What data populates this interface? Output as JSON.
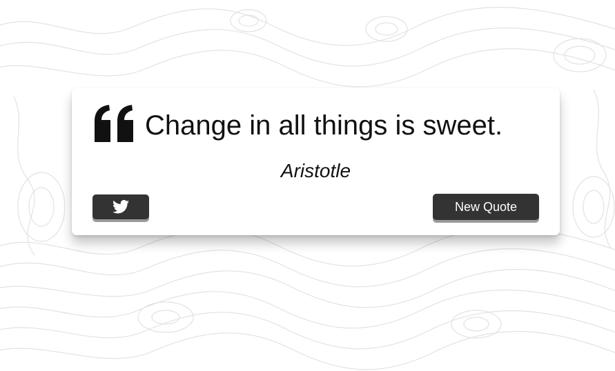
{
  "quote": {
    "text": "Change in all things is sweet.",
    "author": "Aristotle"
  },
  "buttons": {
    "tweet_icon": "twitter-icon",
    "new_quote_label": "New Quote"
  },
  "colors": {
    "background": "#ffffff",
    "topo_lines": "#e2e2e2",
    "card": "#ffffff",
    "text": "#111111",
    "button": "#333333",
    "button_text": "#ffffff"
  }
}
